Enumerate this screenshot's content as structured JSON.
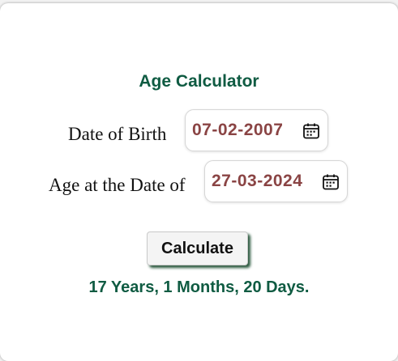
{
  "colors": {
    "accent": "#0f5b42",
    "date": "#8a4444"
  },
  "title": "Age Calculator",
  "dob": {
    "label": "Date of Birth",
    "value": "07-02-2007",
    "icon": "calendar-icon"
  },
  "at_date": {
    "label": "Age at the Date of",
    "value": "27-03-2024",
    "icon": "calendar-icon"
  },
  "calculate_label": "Calculate",
  "result": "17 Years, 1 Months, 20 Days."
}
